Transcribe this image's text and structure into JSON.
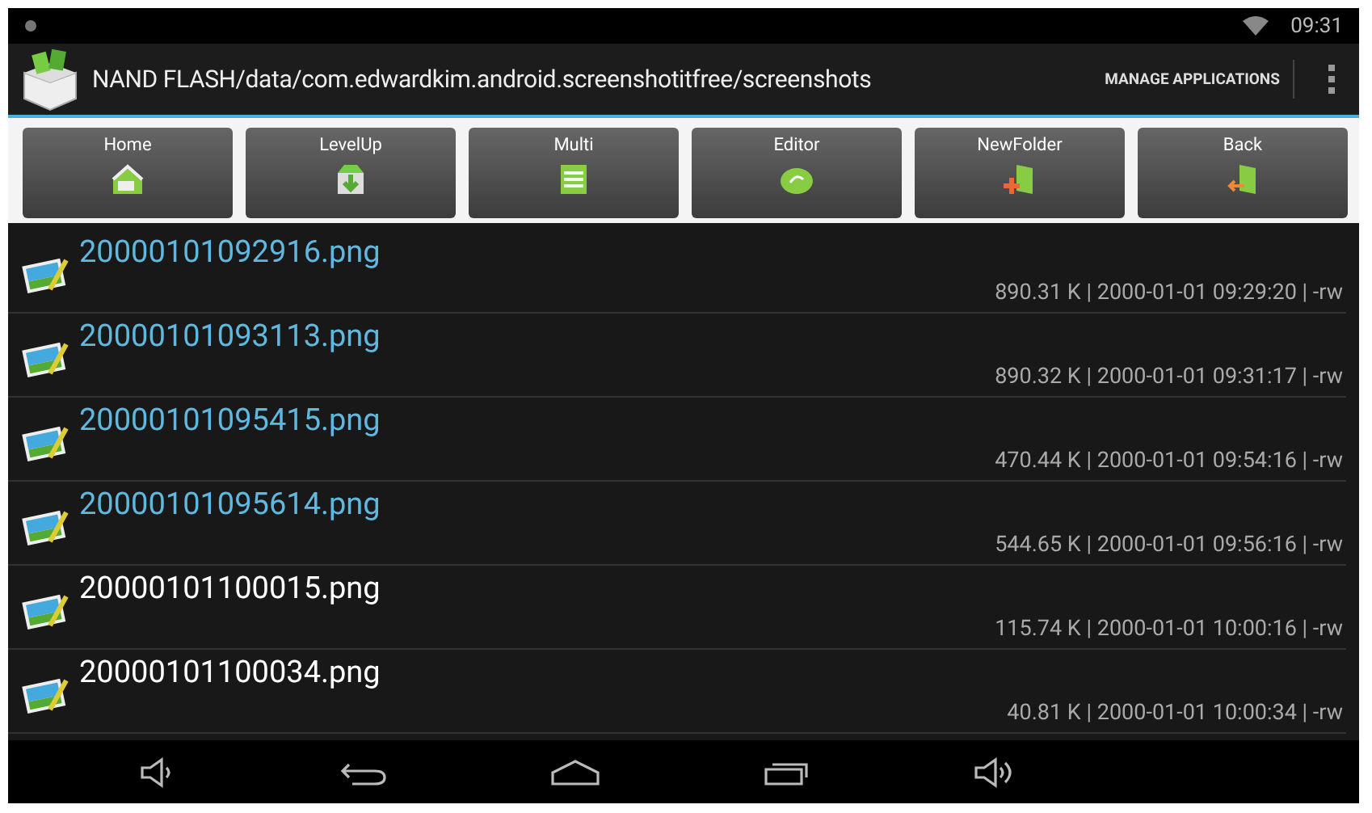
{
  "status_bar": {
    "time": "09:31"
  },
  "action_bar": {
    "path": "NAND FLASH/data/com.edwardkim.android.screenshotitfree/screenshots",
    "action": "MANAGE APPLICATIONS"
  },
  "toolbar": [
    {
      "label": "Home",
      "kind": "home"
    },
    {
      "label": "LevelUp",
      "kind": "levelup"
    },
    {
      "label": "Multi",
      "kind": "multi"
    },
    {
      "label": "Editor",
      "kind": "editor"
    },
    {
      "label": "NewFolder",
      "kind": "newfolder"
    },
    {
      "label": "Back",
      "kind": "back"
    }
  ],
  "files": [
    {
      "name": "20000101092916.png",
      "info": "890.31 K | 2000-01-01 09:29:20 | -rw",
      "selected": true
    },
    {
      "name": "20000101093113.png",
      "info": "890.32 K | 2000-01-01 09:31:17 | -rw",
      "selected": true
    },
    {
      "name": "20000101095415.png",
      "info": "470.44 K | 2000-01-01 09:54:16 | -rw",
      "selected": true
    },
    {
      "name": "20000101095614.png",
      "info": "544.65 K | 2000-01-01 09:56:16 | -rw",
      "selected": true
    },
    {
      "name": "20000101100015.png",
      "info": "115.74 K | 2000-01-01 10:00:16 | -rw",
      "selected": false
    },
    {
      "name": "20000101100034.png",
      "info": "40.81 K | 2000-01-01 10:00:34 | -rw",
      "selected": false
    }
  ]
}
